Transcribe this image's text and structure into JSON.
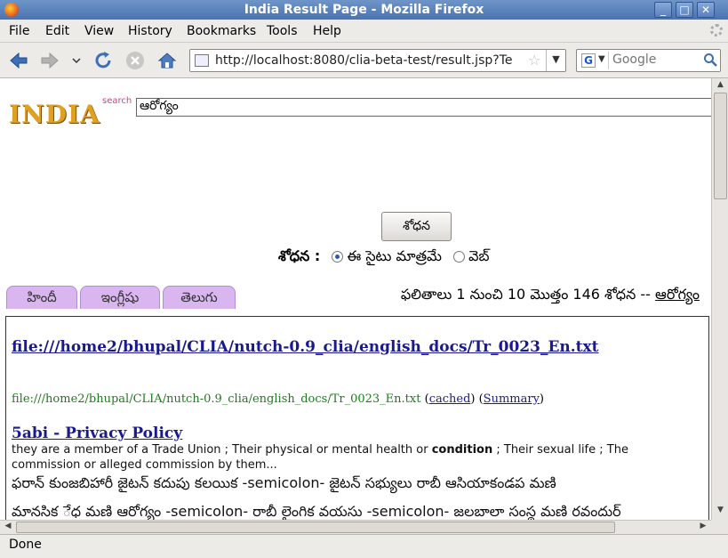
{
  "window": {
    "title": "India Result Page - Mozilla Firefox",
    "buttons": {
      "minimize": "_",
      "maximize": "□",
      "close": "✕"
    }
  },
  "menu": [
    "File",
    "Edit",
    "View",
    "History",
    "Bookmarks",
    "Tools",
    "Help"
  ],
  "nav": {
    "url": "http://localhost:8080/clia-beta-test/result.jsp?Te",
    "search_placeholder": "Google",
    "search_engine_letter": "G"
  },
  "page": {
    "logo": {
      "main": "INDIA",
      "sub": "search"
    },
    "query": "ఆరోగ్యం",
    "search_button": "శోధన",
    "search_label": "శోధన :",
    "radio_options": [
      {
        "label": "ఈ సైటు మాత్రమే",
        "selected": true
      },
      {
        "label": "వెబ్",
        "selected": false
      }
    ],
    "tabs": [
      "హిందీ",
      "ఇంగ్లీషు",
      "తెలుగు"
    ],
    "results_info": {
      "text": "ఫలితాలు 1 నుంచి 10 మొత్తం 146 శోధన -- ",
      "query_link": "ఆరోగ్యం"
    },
    "results": [
      {
        "title": "file:///home2/bhupal/CLIA/nutch-0.9_clia/english_docs/Tr_0023_En.txt",
        "url": "file:///home2/bhupal/CLIA/nutch-0.9_clia/english_docs/Tr_0023_En.txt",
        "cached": "cached",
        "summary": "Summary"
      },
      {
        "title": "5abi - Privacy Policy",
        "snippet_pre": "they are a member of a Trade Union ; Their physical or mental health or ",
        "snippet_bold": "condition",
        "snippet_post": " ; Their sexual life ; The commission or alleged commission by them...",
        "telugu_line1": "ఫరాన్ కుంజబిహారీ జైటన్ కదుపు కలయిక -semicolon- జైటన్ సభ్యులు రాబీ ఆసియాకండప మణి",
        "telugu_line2": "మానసిక ◌ేధ మణి ఆరోగ్యం -semicolon- రాబీ లైంగిక వయసు -semicolon- జలబాలా సంస్థ మణి రవందుర్"
      }
    ]
  },
  "status": "Done"
}
